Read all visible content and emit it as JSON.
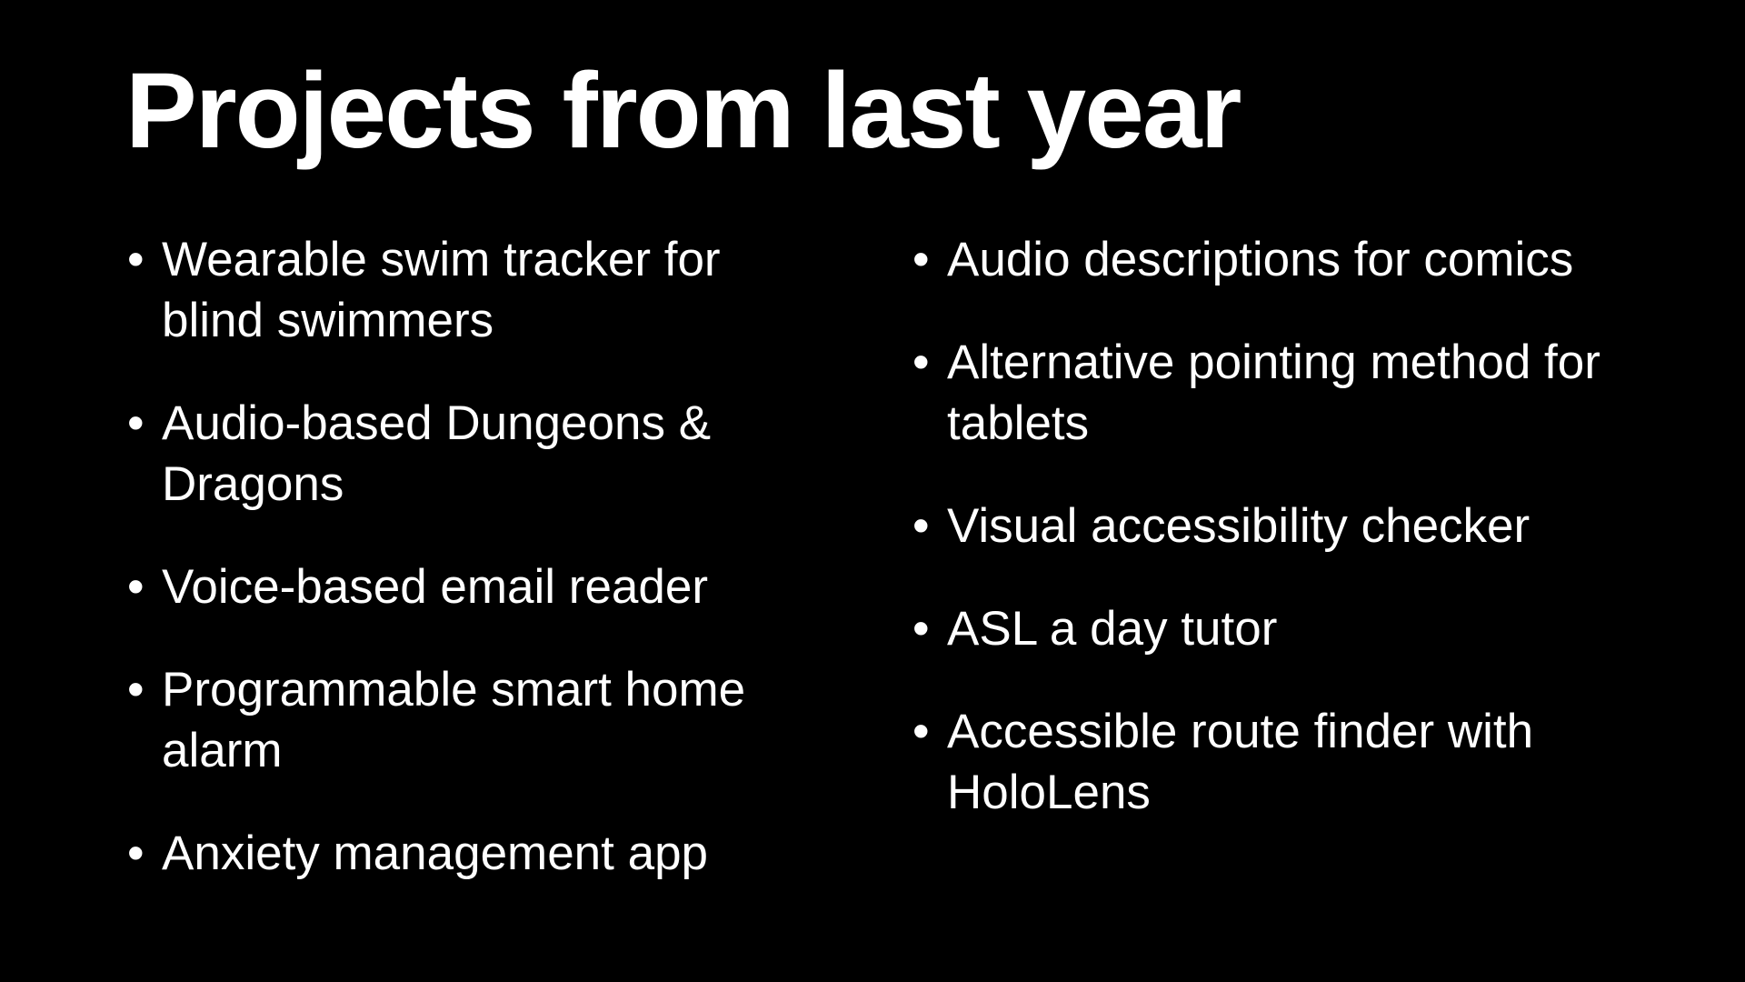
{
  "slide": {
    "title": "Projects from last year",
    "bullet_glyph": "•",
    "left_column": [
      "Wearable swim tracker for blind swimmers",
      "Audio-based Dungeons & Dragons",
      "Voice-based email reader",
      "Programmable smart home alarm",
      "Anxiety management app"
    ],
    "right_column": [
      "Audio descriptions for comics",
      "Alternative pointing method for tablets",
      "Visual accessibility checker",
      "ASL a day tutor",
      "Accessible route finder with HoloLens"
    ]
  },
  "colors": {
    "background": "#000000",
    "text": "#ffffff"
  }
}
